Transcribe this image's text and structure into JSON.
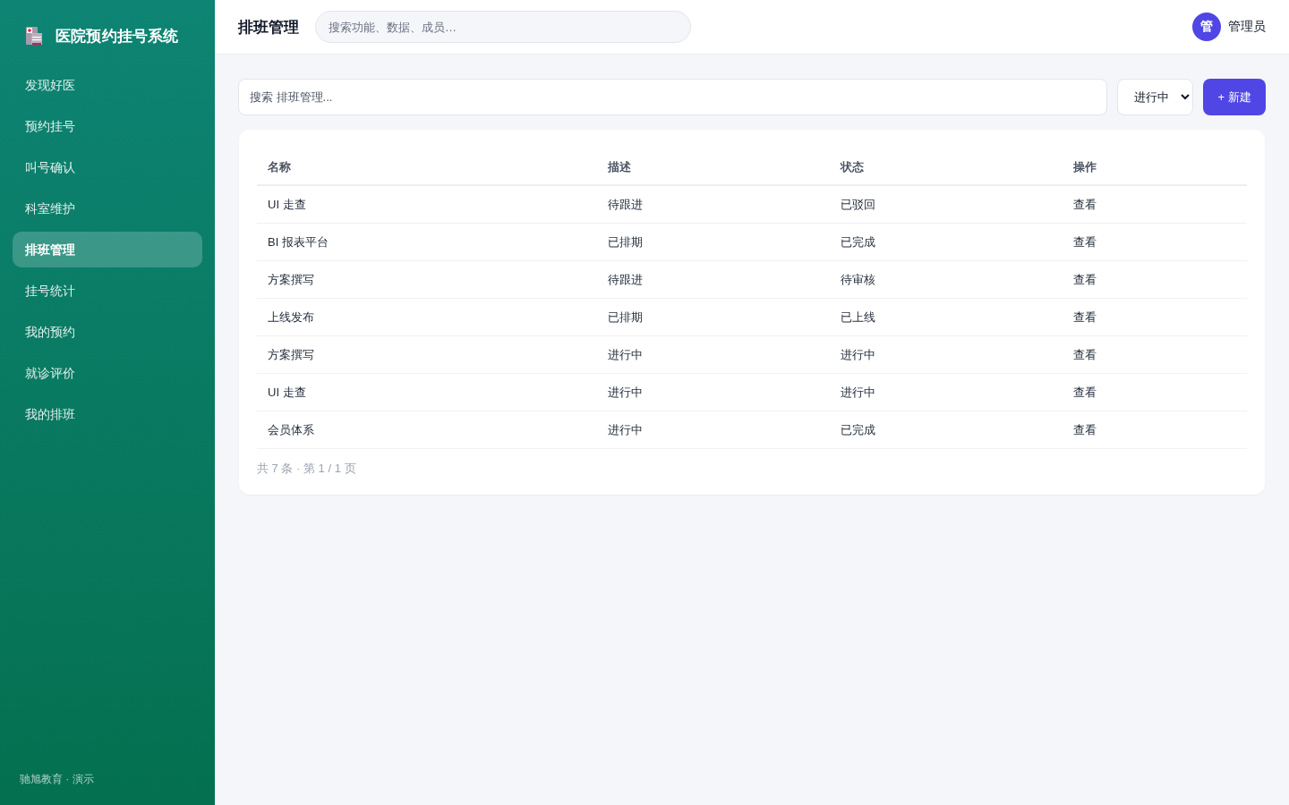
{
  "sidebar": {
    "logo_title": "医院预约挂号系统",
    "items": [
      {
        "label": "发现好医",
        "selected": false
      },
      {
        "label": "预约挂号",
        "selected": false
      },
      {
        "label": "叫号确认",
        "selected": false
      },
      {
        "label": "科室维护",
        "selected": false
      },
      {
        "label": "排班管理",
        "selected": true
      },
      {
        "label": "挂号统计",
        "selected": false
      },
      {
        "label": "我的预约",
        "selected": false
      },
      {
        "label": "就诊评价",
        "selected": false
      },
      {
        "label": "我的排班",
        "selected": false
      }
    ],
    "footer": "驰旭教育 · 演示"
  },
  "topbar": {
    "title": "排班管理",
    "search": {
      "placeholder": "搜索功能、数据、成员…"
    },
    "user": {
      "avatar": "管",
      "name": "管理员"
    }
  },
  "toolbar": {
    "search": {
      "placeholder": "搜索 排班管理..."
    },
    "filter": {
      "value": "进行中"
    },
    "new_button": "+ 新建"
  },
  "table": {
    "columns": [
      "名称",
      "描述",
      "状态",
      "操作"
    ],
    "rows": [
      {
        "name": "UI 走查",
        "description": "待跟进",
        "status": "已驳回",
        "action": "查看"
      },
      {
        "name": "BI 报表平台",
        "description": "已排期",
        "status": "已完成",
        "action": "查看"
      },
      {
        "name": "方案撰写",
        "description": "待跟进",
        "status": "待审核",
        "action": "查看"
      },
      {
        "name": "上线发布",
        "description": "已排期",
        "status": "已上线",
        "action": "查看"
      },
      {
        "name": "方案撰写",
        "description": "进行中",
        "status": "进行中",
        "action": "查看"
      },
      {
        "name": "UI 走查",
        "description": "进行中",
        "status": "进行中",
        "action": "查看"
      },
      {
        "name": "会员体系",
        "description": "进行中",
        "status": "已完成",
        "action": "查看"
      }
    ]
  },
  "pagination": "共 7 条 · 第 1 / 1 页"
}
